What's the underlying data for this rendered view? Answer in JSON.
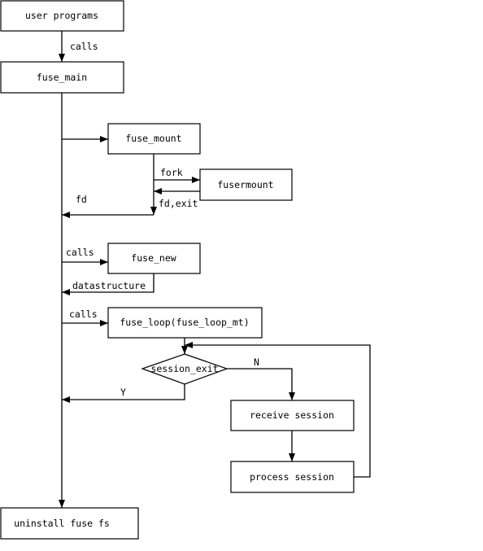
{
  "nodes": {
    "user_programs": "user programs",
    "fuse_main": "fuse_main",
    "fuse_mount": "fuse_mount",
    "fusermount": "fusermount",
    "fuse_new": "fuse_new",
    "fuse_loop": "fuse_loop(fuse_loop_mt)",
    "session_exit": "session_exit",
    "receive_session": "receive session",
    "process_session": "process session",
    "uninstall": "uninstall fuse fs"
  },
  "edges": {
    "calls_main": "calls",
    "fork": "fork",
    "fd_exit": "fd,exit",
    "fd": "fd",
    "calls_new": "calls",
    "datastructure": "datastructure",
    "calls_loop": "calls",
    "no": "N",
    "yes": "Y"
  }
}
